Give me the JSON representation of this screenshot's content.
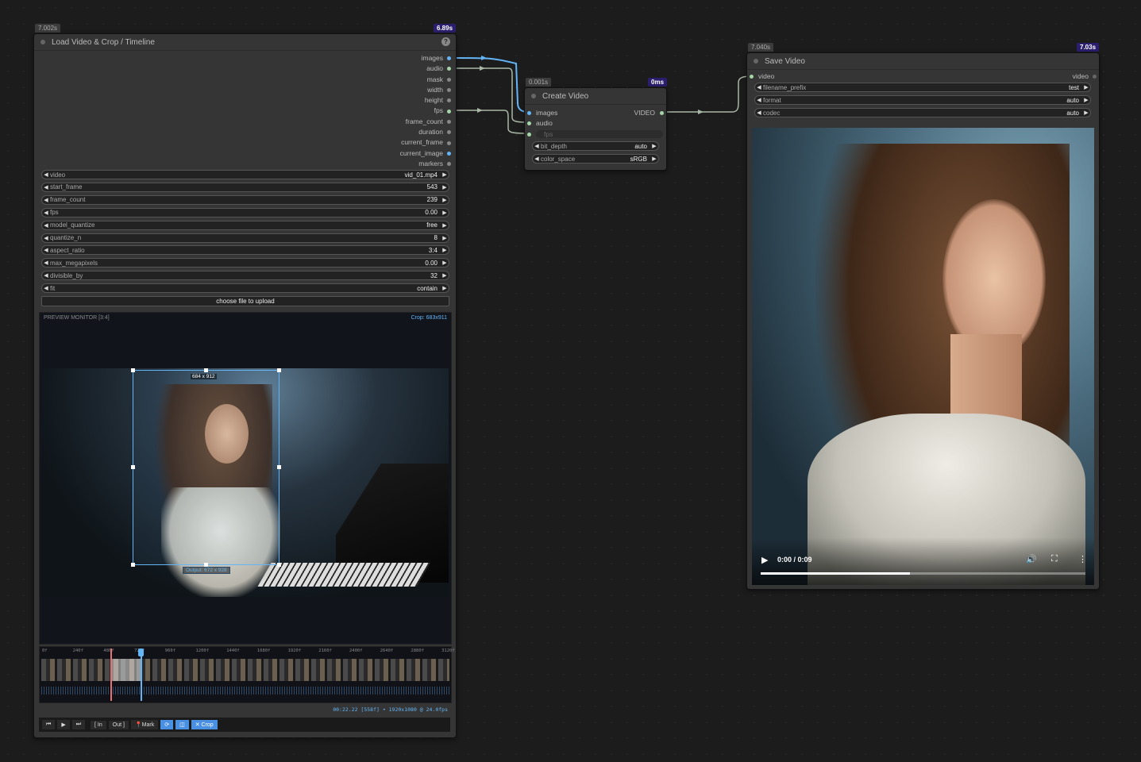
{
  "load_node": {
    "time_badge": "7.002s",
    "exec_badge": "6.89s",
    "title": "Load Video & Crop / Timeline",
    "help": "?",
    "outputs": [
      "images",
      "audio",
      "mask",
      "width",
      "height",
      "fps",
      "frame_count",
      "duration",
      "current_frame",
      "current_image",
      "markers"
    ],
    "widgets": [
      {
        "label": "video",
        "value": "vid_01.mp4"
      },
      {
        "label": "start_frame",
        "value": "543"
      },
      {
        "label": "frame_count",
        "value": "239"
      },
      {
        "label": "fps",
        "value": "0.00"
      },
      {
        "label": "model_quantize",
        "value": "free"
      },
      {
        "label": "quantize_n",
        "value": "8"
      },
      {
        "label": "aspect_ratio",
        "value": "3:4"
      },
      {
        "label": "max_megapixels",
        "value": "0.00"
      },
      {
        "label": "divisible_by",
        "value": "32"
      },
      {
        "label": "fit",
        "value": "contain"
      }
    ],
    "upload_label": "choose file to upload",
    "preview_label": "PREVIEW MONITOR [3:4]",
    "crop_label": "Crop: 683x911",
    "crop_size": "684 x 912",
    "output_size": "Output: 672 x 928",
    "ticks": [
      "0f",
      "240f",
      "480f",
      "720f",
      "960f",
      "1200f",
      "1440f",
      "1680f",
      "1920f",
      "2160f",
      "2400f",
      "2640f",
      "2880f",
      "3120f"
    ],
    "status": "00:22.22 [558f]  •  1920x1080 @ 24.0fps",
    "controls": {
      "prev": "⏮",
      "play": "▶",
      "next": "⏭",
      "in": "[ In",
      "out": "Out ]",
      "mark": "Mark",
      "loop": "⟳",
      "snap": "◫",
      "crop": "✕ Crop"
    }
  },
  "create_node": {
    "time_badge": "0.001s",
    "exec_badge": "0ms",
    "title": "Create Video",
    "inputs": [
      "images",
      "audio",
      "fps"
    ],
    "output": "VIDEO",
    "widgets": [
      {
        "label": "bit_depth",
        "value": "auto"
      },
      {
        "label": "color_space",
        "value": "sRGB"
      }
    ]
  },
  "save_node": {
    "time_badge": "7.040s",
    "exec_badge": "7.03s",
    "title": "Save Video",
    "input": "video",
    "output": "video",
    "widgets": [
      {
        "label": "filename_prefix",
        "value": "test"
      },
      {
        "label": "format",
        "value": "auto"
      },
      {
        "label": "codec",
        "value": "auto"
      }
    ],
    "player_time": "0:00 / 0:09",
    "player_progress": 0.46
  },
  "colors": {
    "images": "#64b5f6",
    "audio": "#a5d6a7",
    "generic": "#a5d6a7",
    "accent": "#4a90e2"
  }
}
